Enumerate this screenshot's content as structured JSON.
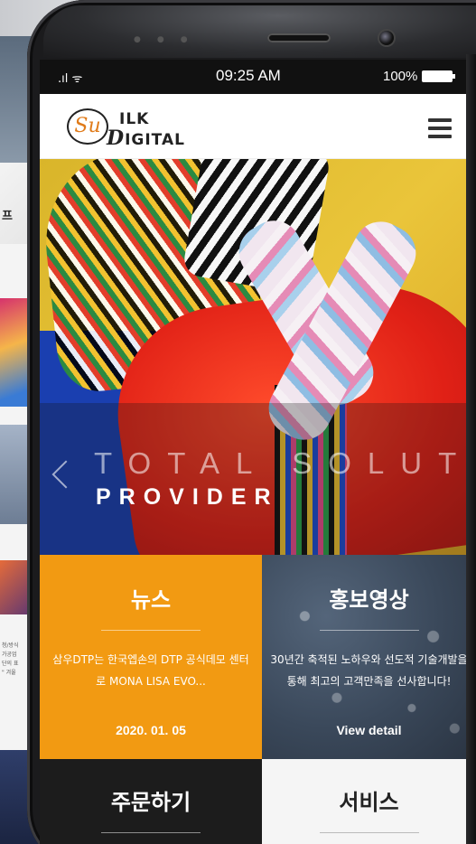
{
  "background_page": {
    "text_1": "프",
    "text_2": "[",
    "small_text": "청/방식\n가공업\n단의 표\n\" 겨울"
  },
  "status_bar": {
    "signal": ".ıl ᯤ",
    "time": "09:25 AM",
    "battery": "100%"
  },
  "header": {
    "logo_mark": "Su",
    "logo_s": "S",
    "logo_line1": "ILK",
    "logo_line2": "IGITAL",
    "logo_d": "D"
  },
  "hero": {
    "line1": "TOTAL SOLUTION",
    "line2": "PROVIDER"
  },
  "tiles": {
    "news": {
      "title": "뉴스",
      "body": "삼우DTP는 한국엡손의 DTP 공식데모 센터로 MONA LISA EVO...",
      "date": "2020. 01. 05"
    },
    "promo": {
      "title": "홍보영상",
      "body": "30년간 축적된 노하우와 선도적 기술개발을 통해 최고의 고객만족을 선사합니다!",
      "link": "View detail"
    },
    "order": {
      "title": "주문하기"
    },
    "service": {
      "title": "서비스"
    }
  },
  "colors": {
    "news_tile": "#f29a12",
    "order_tile": "#1c1c1c",
    "service_tile": "#f5f5f5",
    "logo_accent": "#e07b1a"
  }
}
